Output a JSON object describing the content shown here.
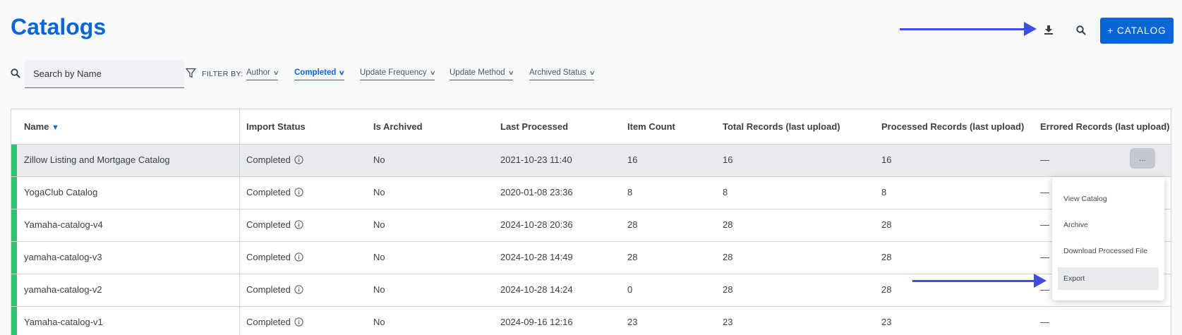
{
  "header": {
    "title": "Catalogs",
    "download_icon": "download-icon",
    "search_icon": "search-icon",
    "add_button_label": "+ CATALOG"
  },
  "search": {
    "placeholder": "Search by Name",
    "value": ""
  },
  "filters": {
    "label": "FILTER BY:",
    "items": [
      {
        "label": "Author",
        "active": false
      },
      {
        "label": "Completed",
        "active": true
      },
      {
        "label": "Update Frequency",
        "active": false
      },
      {
        "label": "Update Method",
        "active": false
      },
      {
        "label": "Archived Status",
        "active": false
      }
    ]
  },
  "table": {
    "columns": [
      "Name",
      "Import Status",
      "Is Archived",
      "Last Processed",
      "Item Count",
      "Total Records (last upload)",
      "Processed Records (last upload)",
      "Errored Records (last upload)"
    ],
    "sort_indicator": "▼",
    "rows": [
      {
        "name": "Zillow Listing and Mortgage Catalog",
        "status": "Completed",
        "archived": "No",
        "last_processed": "2021-10-23 11:40",
        "item_count": "16",
        "total": "16",
        "processed": "16",
        "errored": "—"
      },
      {
        "name": "YogaClub Catalog",
        "status": "Completed",
        "archived": "No",
        "last_processed": "2020-01-08 23:36",
        "item_count": "8",
        "total": "8",
        "processed": "8",
        "errored": "—"
      },
      {
        "name": "Yamaha-catalog-v4",
        "status": "Completed",
        "archived": "No",
        "last_processed": "2024-10-28 20:36",
        "item_count": "28",
        "total": "28",
        "processed": "28",
        "errored": "—"
      },
      {
        "name": "yamaha-catalog-v3",
        "status": "Completed",
        "archived": "No",
        "last_processed": "2024-10-28 14:49",
        "item_count": "28",
        "total": "28",
        "processed": "28",
        "errored": "—"
      },
      {
        "name": "yamaha-catalog-v2",
        "status": "Completed",
        "archived": "No",
        "last_processed": "2024-10-28 14:24",
        "item_count": "0",
        "total": "28",
        "processed": "28",
        "errored": "—"
      },
      {
        "name": "Yamaha-catalog-v1",
        "status": "Completed",
        "archived": "No",
        "last_processed": "2024-09-16 12:16",
        "item_count": "23",
        "total": "23",
        "processed": "23",
        "errored": "—"
      }
    ],
    "status_color": "#2dc572"
  },
  "row_actions": {
    "more_label": "...",
    "menu": [
      "View Catalog",
      "Archive",
      "Download Processed File",
      "Export"
    ]
  },
  "colors": {
    "accent": "#0a66d6",
    "annotation_arrow": "#3f4de0",
    "status_bar": "#2dc572"
  }
}
